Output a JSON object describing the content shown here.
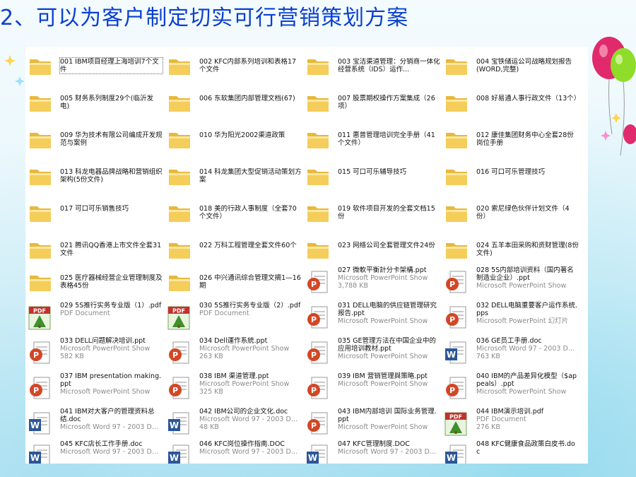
{
  "slide_title": "2、可以为客户制定切实可行营销策划方案",
  "files": [
    {
      "name": "001 IBM项目经理上海培训7个文件",
      "icon": "folder-icon"
    },
    {
      "name": "002 KFC内部系列培训和表格17个文件",
      "icon": "folder-icon"
    },
    {
      "name": "003 宝洁渠道管理：分销商一体化经营系统（IDS）运作...",
      "icon": "folder-icon"
    },
    {
      "name": "004 宝铁储运公司战略规划报告(WORD,完整)",
      "icon": "folder-icon"
    },
    {
      "name": "005 财务系列制度29个(临沂发电)",
      "icon": "folder-icon"
    },
    {
      "name": "006 东软集团内部管理文档(67)",
      "icon": "folder-icon"
    },
    {
      "name": "007 股票期权操作方案集成（26项）",
      "icon": "folder-icon"
    },
    {
      "name": "008 好易通人事行政文件（13个）",
      "icon": "folder-icon"
    },
    {
      "name": "009 华为技术有限公司编成开发规范与案例",
      "icon": "folder-icon"
    },
    {
      "name": "010 华为阳光2002渠道政策",
      "icon": "folder-icon"
    },
    {
      "name": "011 惠普管理培训完全手册（41个文件）",
      "icon": "folder-icon"
    },
    {
      "name": "012 康佳集团财务中心全套28份岗位手册",
      "icon": "folder-icon"
    },
    {
      "name": "013 科龙电器品牌战略和营销组织架构(5份文件)",
      "icon": "folder-icon"
    },
    {
      "name": "014 科龙集团大型促销活动策划方案",
      "icon": "folder-icon"
    },
    {
      "name": "015 可口可乐辅导技巧",
      "icon": "folder-icon"
    },
    {
      "name": "016 可口可乐管理技巧",
      "icon": "folder-icon"
    },
    {
      "name": "017 可口可乐销售技巧",
      "icon": "folder-icon"
    },
    {
      "name": "018 美的行政人事制度（全套70个文件）",
      "icon": "folder-icon"
    },
    {
      "name": "019 软件项目开发的全套文档15份",
      "icon": "folder-icon"
    },
    {
      "name": "020 索尼绿色伙伴计划文件（4份）",
      "icon": "folder-icon"
    },
    {
      "name": "021 腾讯QQ香港上市文件全套31文件",
      "icon": "folder-icon"
    },
    {
      "name": "022 万科工程管理全套文件60个",
      "icon": "folder-icon"
    },
    {
      "name": "023 网络公司全套管理文件24份",
      "icon": "folder-icon"
    },
    {
      "name": "024 五羊本田采购和资财管理(8份文件)",
      "icon": "folder-icon"
    },
    {
      "name": "025 医疗器械经营企业管理制度及表格45份",
      "icon": "folder-icon"
    },
    {
      "name": "026 中兴通讯综合管理文摘1—16期",
      "icon": "folder-icon"
    },
    {
      "name": "027 微軟平衡計分卡架構.ppt",
      "type": "Microsoft PowerPoint Show",
      "size": "3,788 KB",
      "icon": "ppt-icon"
    },
    {
      "name": "028 5S内部培训资料（国内著名制造业企业）.ppt",
      "type": "Microsoft PowerPoint Show",
      "size": "",
      "icon": "ppt-icon"
    },
    {
      "name": "029 5S推行实务专业版（1）.pdf",
      "type": "PDF Document",
      "size": "",
      "icon": "pdf-icon"
    },
    {
      "name": "030 5S推行实务专业版（2）.pdf",
      "type": "PDF Document",
      "size": "",
      "icon": "pdf-icon"
    },
    {
      "name": "031 DELL电脑的供应链管理研究报告.ppt",
      "type": "Microsoft PowerPoint Show",
      "size": "",
      "icon": "ppt-icon"
    },
    {
      "name": "032 DELL电脑重要客户运作系统.pps",
      "type": "Microsoft PowerPoint 幻灯片",
      "size": "",
      "icon": "pps-icon"
    },
    {
      "name": "033 DELL问题解决培训.ppt",
      "type": "Microsoft PowerPoint Show",
      "size": "582 KB",
      "icon": "ppt-icon"
    },
    {
      "name": "034 Dell運作系統.ppt",
      "type": "Microsoft PowerPoint Show",
      "size": "263 KB",
      "icon": "ppt-icon"
    },
    {
      "name": "035 GE管理方法在中国企业中的应用培训教材.ppt",
      "type": "Microsoft PowerPoint Show",
      "size": "",
      "icon": "ppt-icon"
    },
    {
      "name": "036 GE员工手册.doc",
      "type": "Microsoft Word 97 - 2003 Doc...",
      "size": "763 KB",
      "icon": "word-icon"
    },
    {
      "name": "037 IBM presentation making.ppt",
      "type": "Microsoft PowerPoint Show",
      "size": "",
      "icon": "ppt-icon"
    },
    {
      "name": "038 IBM 渠道管理.ppt",
      "type": "Microsoft PowerPoint Show",
      "size": "325 KB",
      "icon": "ppt-icon"
    },
    {
      "name": "039 IBM 营销管理與策略.ppt",
      "type": "Microsoft PowerPoint Show",
      "size": "",
      "icon": "ppt-icon"
    },
    {
      "name": "040 IBM的产品差异化模型（$appeals）.ppt",
      "type": "Microsoft PowerPoint Show",
      "size": "",
      "icon": "ppt-icon"
    },
    {
      "name": "041 IBM对大客户的管理资料总结.doc",
      "type": "Microsoft Word 97 - 2003 Doc...",
      "size": "",
      "icon": "word-icon"
    },
    {
      "name": "042 IBM公司的企业文化.doc",
      "type": "Microsoft Word 97 - 2003 Doc...",
      "size": "48 KB",
      "icon": "word-icon"
    },
    {
      "name": "043 IBM内部培训 国际业务管理.ppt",
      "type": "Microsoft PowerPoint Show",
      "size": "",
      "icon": "ppt-icon"
    },
    {
      "name": "044 IBM演示培训.pdf",
      "type": "PDF Document",
      "size": "276 KB",
      "icon": "pdf-icon"
    },
    {
      "name": "045 KFC店长工作手册.doc",
      "type": "Microsoft Word 97 - 2003 Doc...",
      "size": "",
      "icon": "word-icon"
    },
    {
      "name": "046 KFC岗位操作指南.DOC",
      "type": "Microsoft Word 97 - 2003 Doc...",
      "size": "",
      "icon": "word-icon"
    },
    {
      "name": "047 KFC管理制度.DOC",
      "type": "Microsoft Word 97 - 2003 Doc...",
      "size": "",
      "icon": "word-icon"
    },
    {
      "name": "048 KFC健康食品政策白皮书.doc",
      "type": "",
      "size": "",
      "icon": "word-icon"
    }
  ],
  "colors": {
    "title": "#0a3fd0",
    "folder": "#f4cd5a",
    "ppt": "#d24726",
    "word": "#2b5797",
    "pdf": "#c4302b"
  }
}
